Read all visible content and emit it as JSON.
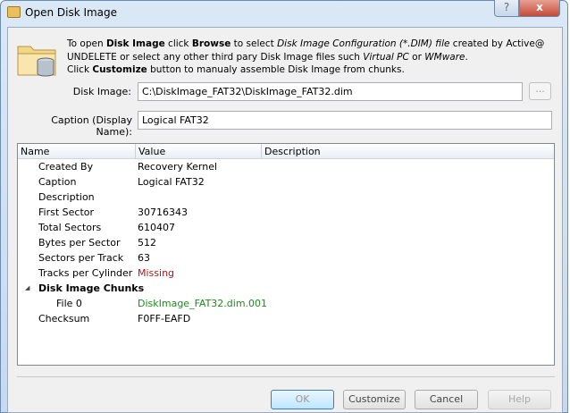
{
  "window": {
    "title": "Open Disk Image",
    "help_label": "?",
    "close_label": "x"
  },
  "info": {
    "line1": [
      {
        "t": "To open ",
        "s": ""
      },
      {
        "t": "Disk Image",
        "s": "b"
      },
      {
        "t": " click ",
        "s": ""
      },
      {
        "t": "Browse",
        "s": "b"
      },
      {
        "t": " to select ",
        "s": ""
      },
      {
        "t": "Disk Image Configuration (*.DIM) file",
        "s": "i"
      },
      {
        "t": " created by Active@",
        "s": ""
      }
    ],
    "line2": [
      {
        "t": "UNDELETE or select any other third pary Disk Image files such ",
        "s": ""
      },
      {
        "t": "Virtual PC",
        "s": "i"
      },
      {
        "t": " or ",
        "s": ""
      },
      {
        "t": "WMware",
        "s": "i"
      },
      {
        "t": ".",
        "s": ""
      }
    ],
    "line3": [
      {
        "t": "Click ",
        "s": ""
      },
      {
        "t": "Customize",
        "s": "b"
      },
      {
        "t": " button to manualy assemble Disk Image from chunks.",
        "s": ""
      }
    ]
  },
  "form": {
    "disk_image_label": "Disk Image:",
    "disk_image_value": "C:\\DiskImage_FAT32\\DiskImage_FAT32.dim",
    "browse_label": "...",
    "caption_label": "Caption (Display Name):",
    "caption_value": "Logical FAT32"
  },
  "table": {
    "columns": [
      "Name",
      "Value",
      "Description"
    ],
    "rows": [
      {
        "name": "Created By",
        "value": "Recovery Kernel"
      },
      {
        "name": "Caption",
        "value": "Logical FAT32"
      },
      {
        "name": "Description",
        "value": ""
      },
      {
        "name": "First Sector",
        "value": "30716343"
      },
      {
        "name": "Total Sectors",
        "value": "610407"
      },
      {
        "name": "Bytes per Sector",
        "value": "512"
      },
      {
        "name": "Sectors per Track",
        "value": "63"
      },
      {
        "name": "Tracks per Cylinder",
        "value": "Missing",
        "color": "#b01818"
      },
      {
        "name": "Disk Image Chunks",
        "value": "",
        "group": true
      },
      {
        "name": "File 0",
        "value": "DiskImage_FAT32.dim.001",
        "color": "#1e8a1e",
        "indent": true
      },
      {
        "name": "Checksum",
        "value": "F0FF-EAFD"
      }
    ]
  },
  "buttons": {
    "ok": "OK",
    "customize": "Customize",
    "cancel": "Cancel",
    "help": "Help"
  }
}
